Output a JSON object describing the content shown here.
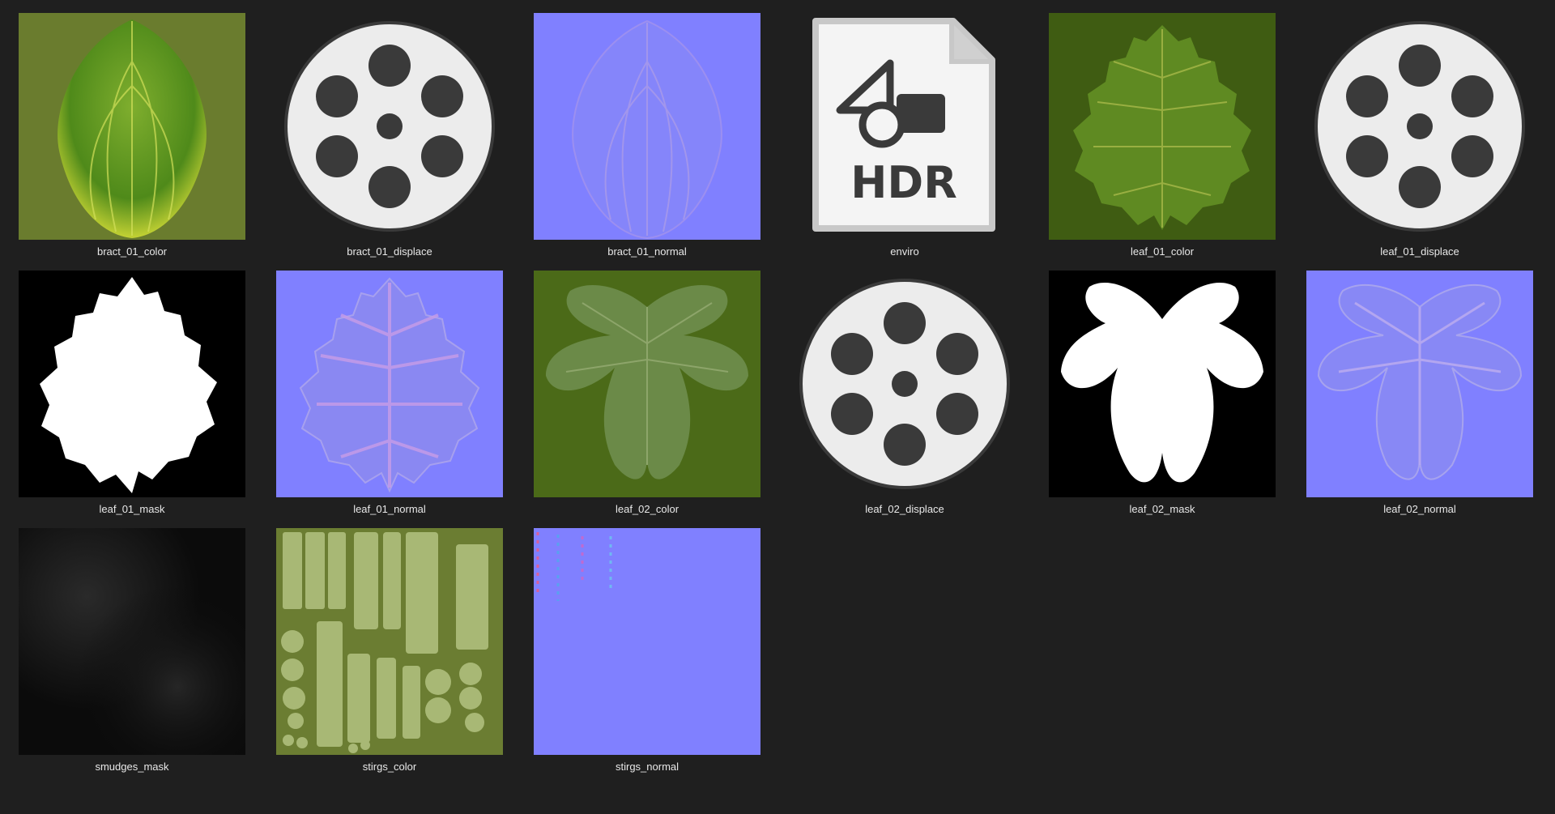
{
  "files": [
    {
      "name": "bract_01_color",
      "kind": "bract-color"
    },
    {
      "name": "bract_01_displace",
      "kind": "video"
    },
    {
      "name": "bract_01_normal",
      "kind": "bract-normal"
    },
    {
      "name": "enviro",
      "kind": "hdr",
      "badge": "HDR"
    },
    {
      "name": "leaf_01_color",
      "kind": "leaf1-color"
    },
    {
      "name": "leaf_01_displace",
      "kind": "video"
    },
    {
      "name": "leaf_01_mask",
      "kind": "leaf1-mask"
    },
    {
      "name": "leaf_01_normal",
      "kind": "leaf1-normal"
    },
    {
      "name": "leaf_02_color",
      "kind": "leaf2-color"
    },
    {
      "name": "leaf_02_displace",
      "kind": "video"
    },
    {
      "name": "leaf_02_mask",
      "kind": "leaf2-mask"
    },
    {
      "name": "leaf_02_normal",
      "kind": "leaf2-normal"
    },
    {
      "name": "smudges_mask",
      "kind": "smudges"
    },
    {
      "name": "stirgs_color",
      "kind": "strings-color"
    },
    {
      "name": "stirgs_normal",
      "kind": "strings-normal"
    }
  ],
  "colors": {
    "background": "#1f1f1f",
    "label": "#e8e8e8",
    "bract_bg": "#6a7c2e",
    "leaf1_bg": "#3f5c12",
    "leaf2_bg": "#4b6a18",
    "normal_bg": "#8080ff",
    "mask_bg": "#000000",
    "strings_bg": "#6b7d32"
  }
}
